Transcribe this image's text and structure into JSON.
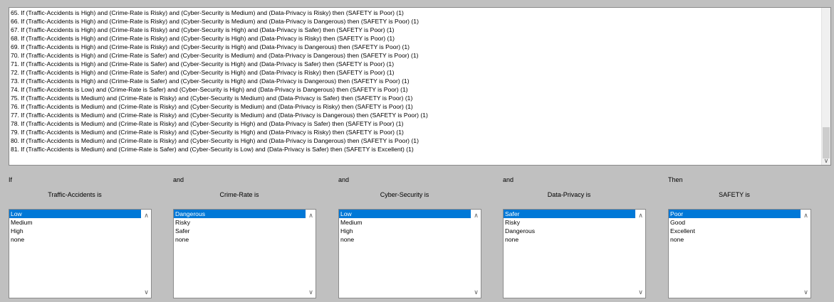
{
  "rules": [
    "65. If (Traffic-Accidents is High) and (Crime-Rate is Risky) and (Cyber-Security is Medium) and (Data-Privacy is Risky) then (SAFETY is Poor) (1)",
    "66. If (Traffic-Accidents is High) and (Crime-Rate is Risky) and (Cyber-Security is Medium) and (Data-Privacy is Dangerous) then (SAFETY is Poor) (1)",
    "67. If (Traffic-Accidents is High) and (Crime-Rate is Risky) and (Cyber-Security is High) and (Data-Privacy is Safer) then (SAFETY is Poor) (1)",
    "68. If (Traffic-Accidents is High) and (Crime-Rate is Risky) and (Cyber-Security is High) and (Data-Privacy is Risky) then (SAFETY is Poor) (1)",
    "69. If (Traffic-Accidents is High) and (Crime-Rate is Risky) and (Cyber-Security is High) and (Data-Privacy is Dangerous) then (SAFETY is Poor) (1)",
    "70. If (Traffic-Accidents is High) and (Crime-Rate is Safer) and (Cyber-Security is Medium) and (Data-Privacy is Dangerous) then (SAFETY is Poor) (1)",
    "71. If (Traffic-Accidents is High) and (Crime-Rate is Safer) and (Cyber-Security is High) and (Data-Privacy is Safer) then (SAFETY is Poor) (1)",
    "72. If (Traffic-Accidents is High) and (Crime-Rate is Safer) and (Cyber-Security is High) and (Data-Privacy is Risky) then (SAFETY is Poor) (1)",
    "73. If (Traffic-Accidents is High) and (Crime-Rate is Safer) and (Cyber-Security is High) and (Data-Privacy is Dangerous) then (SAFETY is Poor) (1)",
    "74. If (Traffic-Accidents is Low) and (Crime-Rate is Safer) and (Cyber-Security is High) and (Data-Privacy is Dangerous) then (SAFETY is Poor) (1)",
    "75. If (Traffic-Accidents is Medium) and (Crime-Rate is Risky) and (Cyber-Security is Medium) and (Data-Privacy is Safer) then (SAFETY is Poor) (1)",
    "76. If (Traffic-Accidents is Medium) and (Crime-Rate is Risky) and (Cyber-Security is Medium) and (Data-Privacy is Risky) then (SAFETY is Poor) (1)",
    "77. If (Traffic-Accidents is Medium) and (Crime-Rate is Risky) and (Cyber-Security is Medium) and (Data-Privacy is Dangerous) then (SAFETY is Poor) (1)",
    "78. If (Traffic-Accidents is Medium) and (Crime-Rate is Risky) and (Cyber-Security is High) and (Data-Privacy is Safer) then (SAFETY is Poor) (1)",
    "79. If (Traffic-Accidents is Medium) and (Crime-Rate is Risky) and (Cyber-Security is High) and (Data-Privacy is Risky) then (SAFETY is Poor) (1)",
    "80. If (Traffic-Accidents is Medium) and (Crime-Rate is Risky) and (Cyber-Security is High) and (Data-Privacy is Dangerous) then (SAFETY is Poor) (1)",
    "81. If (Traffic-Accidents is Medium) and (Crime-Rate is Safer) and (Cyber-Security is Low) and (Data-Privacy is Safer) then (SAFETY is Excellent) (1)"
  ],
  "panels": [
    {
      "conj": "If",
      "var": "Traffic-Accidents is",
      "options": [
        "Low",
        "Medium",
        "High",
        "none"
      ],
      "selected": "Low"
    },
    {
      "conj": "and",
      "var": "Crime-Rate is",
      "options": [
        "Dangerous",
        "Risky",
        "Safer",
        "none"
      ],
      "selected": "Dangerous"
    },
    {
      "conj": "and",
      "var": "Cyber-Security is",
      "options": [
        "Low",
        "Medium",
        "High",
        "none"
      ],
      "selected": "Low"
    },
    {
      "conj": "and",
      "var": "Data-Privacy is",
      "options": [
        "Safer",
        "Risky",
        "Dangerous",
        "none"
      ],
      "selected": "Safer"
    },
    {
      "conj": "Then",
      "var": "SAFETY is",
      "options": [
        "Poor",
        "Good",
        "Excellent",
        "none"
      ],
      "selected": "Poor"
    }
  ],
  "icons": {
    "scroll_up": "chevron-up-icon",
    "scroll_down": "chevron-down-icon"
  },
  "colors": {
    "selection": "#0078d7",
    "background": "#c0c0c0"
  }
}
